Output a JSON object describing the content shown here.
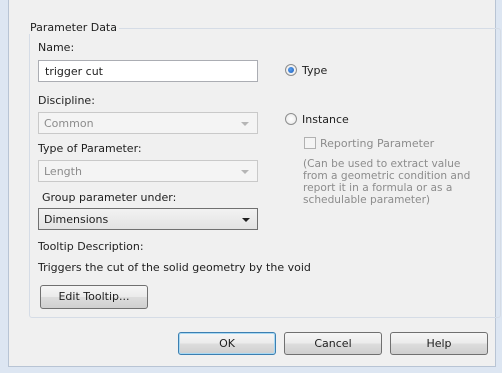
{
  "group_title": "Parameter Data",
  "name": {
    "label": "Name:",
    "value": "trigger cut"
  },
  "discipline": {
    "label": "Discipline:",
    "value": "Common"
  },
  "type_of_parameter": {
    "label": "Type of Parameter:",
    "value": "Length"
  },
  "group_under": {
    "label": "Group parameter under:",
    "value": "Dimensions"
  },
  "tooltip": {
    "label": "Tooltip Description:",
    "text": "Triggers the cut of the solid geometry by the void",
    "edit_button": "Edit Tooltip..."
  },
  "radio_type": {
    "label": "Type",
    "selected": true
  },
  "radio_instance": {
    "label": "Instance",
    "selected": false
  },
  "reporting": {
    "label": "Reporting Parameter",
    "checked": false,
    "note": "(Can be used to extract value from a geometric condition and report it in a formula or as a schedulable parameter)"
  },
  "buttons": {
    "ok": "OK",
    "cancel": "Cancel",
    "help": "Help"
  }
}
